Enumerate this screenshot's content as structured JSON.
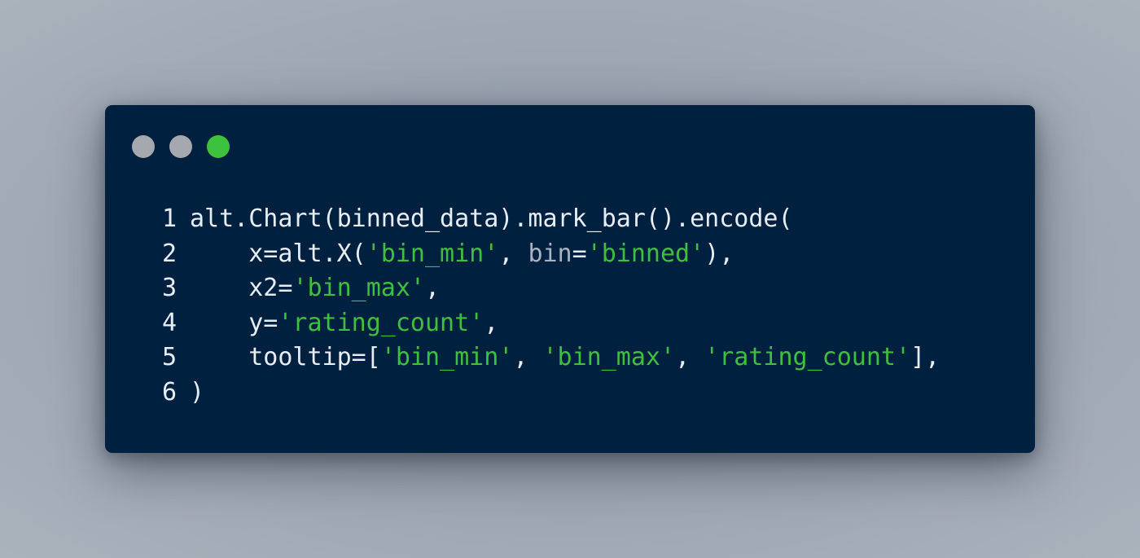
{
  "window": {
    "background": "#00203f",
    "controls": [
      {
        "name": "close",
        "color": "#a5a9af"
      },
      {
        "name": "minimize",
        "color": "#a5a9af"
      },
      {
        "name": "maximize",
        "color": "#3cc23c"
      }
    ]
  },
  "colors": {
    "code_text": "#e6edf3",
    "string": "#3fbf3f",
    "keyword_argument": "#a8b3bf"
  },
  "code": {
    "lines": [
      {
        "number": "1",
        "tokens": [
          {
            "text": "alt.Chart(binned_data).mark_bar().encode(",
            "kind": "plain"
          }
        ]
      },
      {
        "number": "2",
        "tokens": [
          {
            "text": "    x=alt.X(",
            "kind": "plain"
          },
          {
            "text": "'bin_min'",
            "kind": "string"
          },
          {
            "text": ", ",
            "kind": "plain"
          },
          {
            "text": "bin",
            "kind": "kwarg"
          },
          {
            "text": "=",
            "kind": "plain"
          },
          {
            "text": "'binned'",
            "kind": "string"
          },
          {
            "text": "),",
            "kind": "plain"
          }
        ]
      },
      {
        "number": "3",
        "tokens": [
          {
            "text": "    x2=",
            "kind": "plain"
          },
          {
            "text": "'bin_max'",
            "kind": "string"
          },
          {
            "text": ",",
            "kind": "plain"
          }
        ]
      },
      {
        "number": "4",
        "tokens": [
          {
            "text": "    y=",
            "kind": "plain"
          },
          {
            "text": "'rating_count'",
            "kind": "string"
          },
          {
            "text": ",",
            "kind": "plain"
          }
        ]
      },
      {
        "number": "5",
        "tokens": [
          {
            "text": "    tooltip=[",
            "kind": "plain"
          },
          {
            "text": "'bin_min'",
            "kind": "string"
          },
          {
            "text": ", ",
            "kind": "plain"
          },
          {
            "text": "'bin_max'",
            "kind": "string"
          },
          {
            "text": ", ",
            "kind": "plain"
          },
          {
            "text": "'rating_count'",
            "kind": "string"
          },
          {
            "text": "],",
            "kind": "plain"
          }
        ]
      },
      {
        "number": "6",
        "tokens": [
          {
            "text": ")",
            "kind": "plain"
          }
        ]
      }
    ]
  }
}
